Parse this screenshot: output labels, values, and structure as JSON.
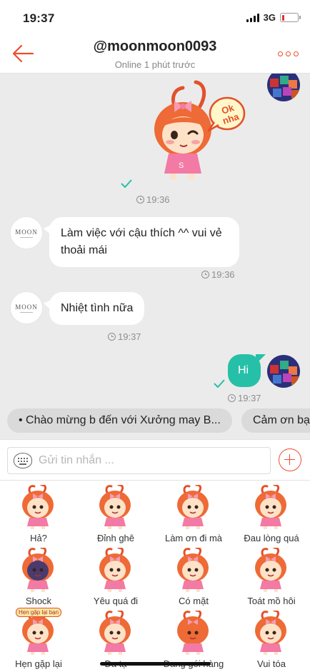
{
  "status_bar": {
    "time": "19:37",
    "network": "3G",
    "battery_level": 0.15
  },
  "header": {
    "title": "@moonmoon0093",
    "subtitle": "Online 1 phút trước",
    "accent_color": "#ee4d2d"
  },
  "chat": {
    "timestamps": {
      "sticker": "19:36",
      "msg1": "19:36",
      "msg2": "19:37",
      "msg3": "19:37"
    },
    "shop_logo": "MOON",
    "messages": {
      "msg1": "Làm việc với cậu thích ^^ vui vẻ thoải mái",
      "msg2": "Nhiệt tình nữa",
      "msg3": "Hi"
    },
    "sticker_text": "Ok nha"
  },
  "quick_replies": [
    "• Chào mừng b đến với Xưởng may B...",
    "Cảm ơn bạn"
  ],
  "input": {
    "placeholder": "Gửi tin nhắn ..."
  },
  "stickers": [
    "Hả?",
    "Đỉnh ghê",
    "Làm ơn đi mà",
    "Đau lòng quá",
    "Shock",
    "Yêu quá đi",
    "Có mặt",
    "Toát mồ hôi",
    "Hẹn gặp lại",
    "Đa tạ",
    "Đang gói hàng",
    "Vui tóa"
  ],
  "sticker_captions": {
    "hen_gap_lai": "Hẹn gặp lại bạn"
  }
}
